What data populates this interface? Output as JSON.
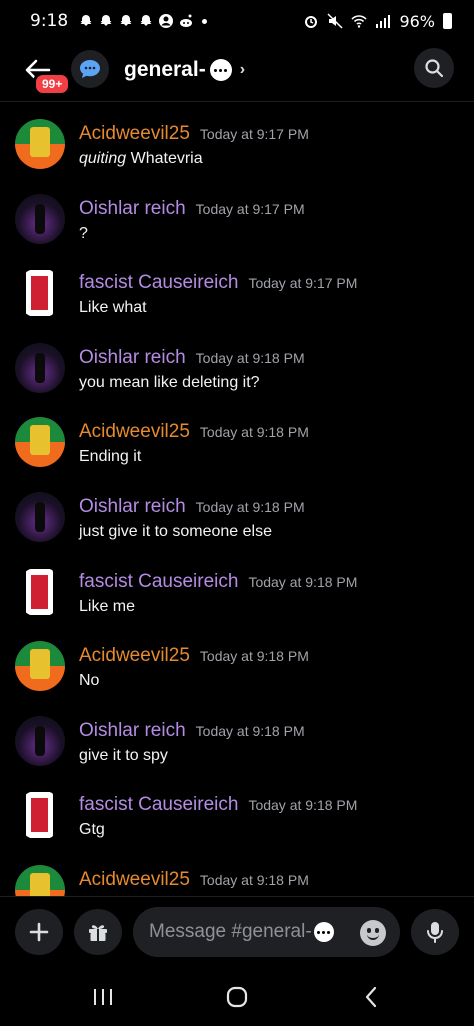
{
  "status_bar": {
    "time": "9:18",
    "battery": "96%"
  },
  "header": {
    "badge_count": "99+",
    "channel_name": "general-"
  },
  "messages": [
    {
      "user": "Acidweevil25",
      "time": "Today at 9:17 PM",
      "text_italic": "quiting",
      "text": " Whatevria",
      "avatar": "acid"
    },
    {
      "user": "Oishlar reich",
      "time": "Today at 9:17 PM",
      "text_italic": "",
      "text": "?",
      "avatar": "oish"
    },
    {
      "user": "fascist Causeireich",
      "time": "Today at 9:17 PM",
      "text_italic": "",
      "text": "Like what",
      "avatar": "fasc"
    },
    {
      "user": "Oishlar reich",
      "time": "Today at 9:18 PM",
      "text_italic": "",
      "text": "you mean like deleting it?",
      "avatar": "oish"
    },
    {
      "user": "Acidweevil25",
      "time": "Today at 9:18 PM",
      "text_italic": "",
      "text": "Ending it",
      "avatar": "acid"
    },
    {
      "user": "Oishlar reich",
      "time": "Today at 9:18 PM",
      "text_italic": "",
      "text": "just give it to someone else",
      "avatar": "oish"
    },
    {
      "user": "fascist Causeireich",
      "time": "Today at 9:18 PM",
      "text_italic": "",
      "text": "Like me",
      "avatar": "fasc"
    },
    {
      "user": "Acidweevil25",
      "time": "Today at 9:18 PM",
      "text_italic": "",
      "text": "No",
      "avatar": "acid"
    },
    {
      "user": "Oishlar reich",
      "time": "Today at 9:18 PM",
      "text_italic": "",
      "text": "give it to spy",
      "avatar": "oish"
    },
    {
      "user": "fascist Causeireich",
      "time": "Today at 9:18 PM",
      "text_italic": "",
      "text": "Gtg",
      "avatar": "fasc"
    },
    {
      "user": "Acidweevil25",
      "time": "Today at 9:18 PM",
      "text_italic": "",
      "text": "",
      "avatar": "acid"
    }
  ],
  "composer": {
    "placeholder": "Message #general-"
  },
  "colors": {
    "background": "#000000",
    "acid_name": "#e58a2f",
    "purple_name": "#b48ce3",
    "timestamp": "#a0a3a9",
    "badge": "#f23f43"
  },
  "icons": {
    "back": "arrow-left-icon",
    "channel": "chat-bubble-icon",
    "search": "search-icon",
    "plus": "plus-icon",
    "gift": "gift-icon",
    "emoji": "emoji-icon",
    "mic": "microphone-icon"
  }
}
